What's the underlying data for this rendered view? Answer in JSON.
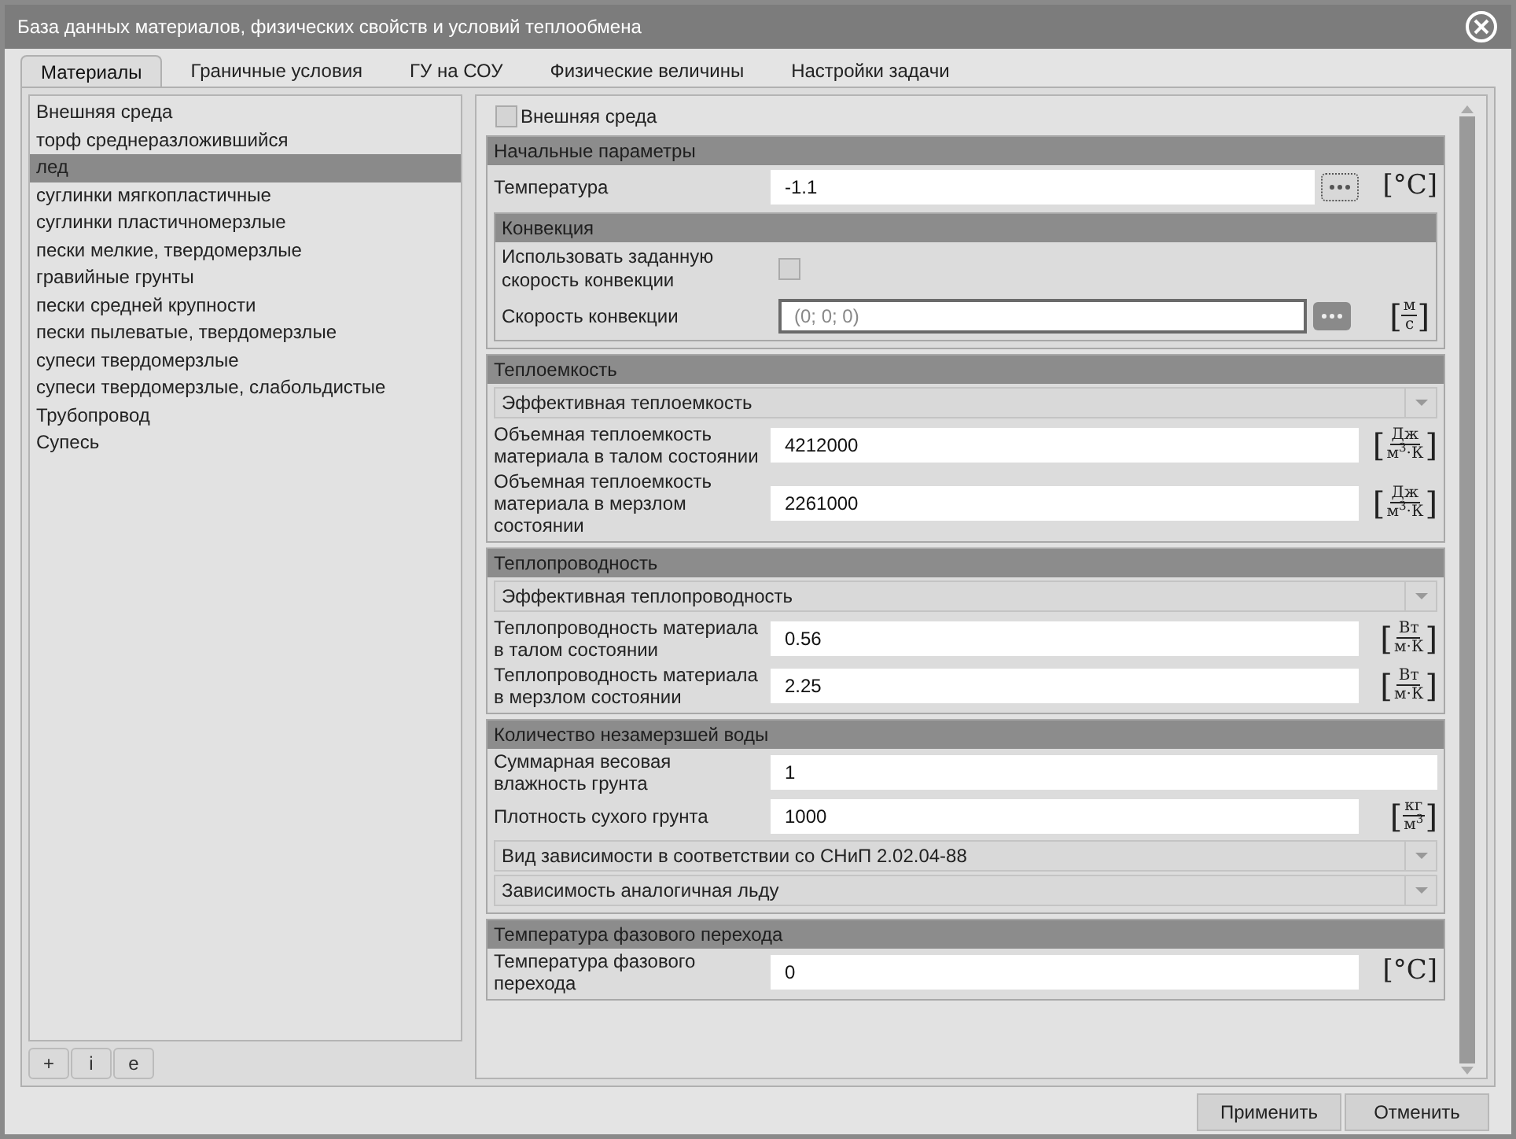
{
  "window": {
    "title": "База данных материалов, физических свойств и условий теплообмена"
  },
  "tabs": [
    {
      "label": "Материалы",
      "selected": true
    },
    {
      "label": "Граничные условия",
      "selected": false
    },
    {
      "label": "ГУ на СОУ",
      "selected": false
    },
    {
      "label": "Физические величины",
      "selected": false
    },
    {
      "label": "Настройки задачи",
      "selected": false
    }
  ],
  "materials": [
    {
      "label": "Внешняя среда",
      "selected": false
    },
    {
      "label": "торф среднеразложившийся",
      "selected": false
    },
    {
      "label": "лед",
      "selected": true
    },
    {
      "label": "суглинки мягкопластичные",
      "selected": false
    },
    {
      "label": "суглинки пластичномерзлые",
      "selected": false
    },
    {
      "label": "пески мелкие, твердомерзлые",
      "selected": false
    },
    {
      "label": "гравийные грунты",
      "selected": false
    },
    {
      "label": "пески средней крупности",
      "selected": false
    },
    {
      "label": "пески пылеватые, твердомерзлые",
      "selected": false
    },
    {
      "label": "супеси твердомерзлые",
      "selected": false
    },
    {
      "label": "супеси твердомерзлые, слабольдистые",
      "selected": false
    },
    {
      "label": "Трубопровод",
      "selected": false
    },
    {
      "label": "Супесь",
      "selected": false
    }
  ],
  "list_buttons": [
    "+",
    "i",
    "e"
  ],
  "external": {
    "label": "Внешняя среда",
    "checked": false
  },
  "sections": [
    {
      "title": "Начальные параметры",
      "rows": [
        {
          "kind": "input",
          "label": "Температура",
          "value": "-1.1",
          "ellipsis": true,
          "disabled": false,
          "unit": {
            "kind": "plain",
            "text": "[°C]"
          }
        },
        {
          "kind": "group",
          "title": "Конвекция",
          "rows": [
            {
              "kind": "checkbox",
              "label": "Использовать заданную скорость конвекции",
              "checked": false
            },
            {
              "kind": "input",
              "label": "Скорость конвекции",
              "value": "(0; 0; 0)",
              "ellipsis": true,
              "disabled": true,
              "unit": {
                "kind": "fraction",
                "open": "[",
                "num": "м",
                "den": "с",
                "close": "]"
              }
            }
          ]
        }
      ]
    },
    {
      "title": "Теплоемкость",
      "rows": [
        {
          "kind": "dropdown",
          "value": "Эффективная теплоемкость"
        },
        {
          "kind": "input",
          "label": "Объемная теплоемкость материала в талом состоянии",
          "value": "4212000",
          "disabled": false,
          "unit": {
            "kind": "fraction",
            "open": "[",
            "num": "Дж",
            "den": "м$^{3}$·К",
            "close": "]"
          }
        },
        {
          "kind": "input",
          "label": "Объемная теплоемкость материала в мерзлом состоянии",
          "value": "2261000",
          "disabled": false,
          "unit": {
            "kind": "fraction",
            "open": "[",
            "num": "Дж",
            "den": "м$^{3}$·К",
            "close": "]"
          }
        }
      ]
    },
    {
      "title": "Теплопроводность",
      "rows": [
        {
          "kind": "dropdown",
          "value": "Эффективная теплопроводность"
        },
        {
          "kind": "input",
          "label": "Теплопроводность материала в талом состоянии",
          "value": "0.56",
          "disabled": false,
          "unit": {
            "kind": "fraction",
            "open": "[",
            "num": "Вт",
            "den": "м·К",
            "close": "]"
          }
        },
        {
          "kind": "input",
          "label": "Теплопроводность материала в мерзлом состоянии",
          "value": "2.25",
          "disabled": false,
          "unit": {
            "kind": "fraction",
            "open": "[",
            "num": "Вт",
            "den": "м·К",
            "close": "]"
          }
        }
      ]
    },
    {
      "title": "Количество незамерзшей воды",
      "rows": [
        {
          "kind": "input",
          "label": "Суммарная весовая влажность грунта",
          "value": "1",
          "disabled": false
        },
        {
          "kind": "input",
          "label": "Плотность сухого грунта",
          "value": "1000",
          "disabled": false,
          "unit": {
            "kind": "fraction",
            "open": "[",
            "num": "кг",
            "den": "м$^{3}$",
            "close": "]"
          }
        },
        {
          "kind": "dropdown",
          "value": "Вид зависимости в соответствии со СНиП 2.02.04-88"
        },
        {
          "kind": "dropdown",
          "value": "Зависимость аналогичная льду"
        }
      ]
    },
    {
      "title": "Температура фазового перехода",
      "rows": [
        {
          "kind": "input",
          "label": "Температура фазового перехода",
          "value": "0",
          "disabled": false,
          "unit": {
            "kind": "plain",
            "text": "[°C]"
          }
        }
      ]
    }
  ],
  "footer_buttons": [
    "Применить",
    "Отменить"
  ]
}
